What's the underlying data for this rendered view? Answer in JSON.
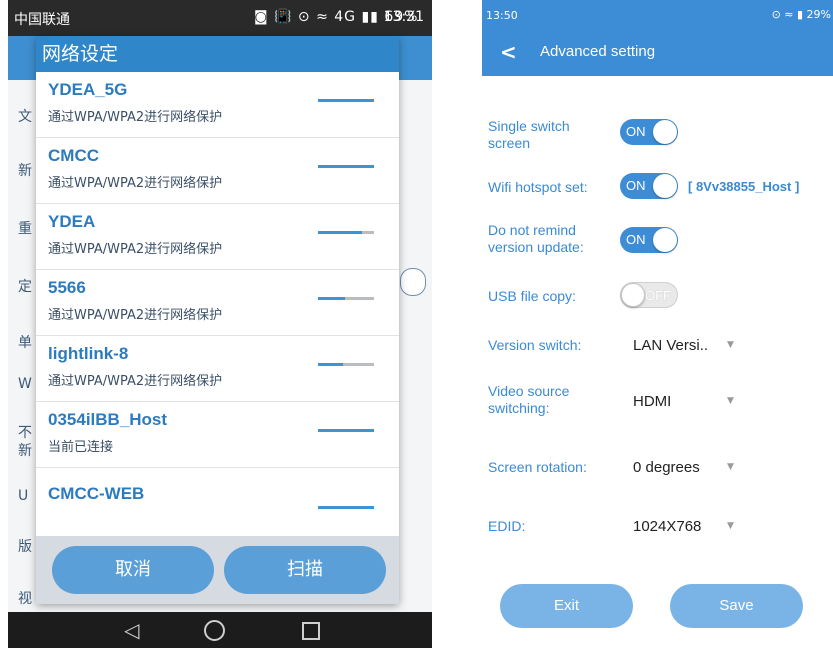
{
  "left": {
    "status": {
      "carrier": "中国联通",
      "icons": "◙ 📳 ⊙ ≈ 4G ▮▮ ",
      "battery": "69%",
      "time": "13:31"
    },
    "background_rows": [
      "文",
      "新",
      "重",
      "定",
      "单",
      "W",
      "不",
      "新",
      "U",
      "版",
      "视"
    ],
    "dialog": {
      "title": "网络设定",
      "networks": [
        {
          "ssid": "YDEA_5G",
          "status": "通过WPA/WPA2进行网络保护",
          "signal": 1.0
        },
        {
          "ssid": "CMCC",
          "status": "通过WPA/WPA2进行网络保护",
          "signal": 1.0
        },
        {
          "ssid": "YDEA",
          "status": "通过WPA/WPA2进行网络保护",
          "signal": 0.78
        },
        {
          "ssid": "5566",
          "status": "通过WPA/WPA2进行网络保护",
          "signal": 0.48
        },
        {
          "ssid": "lightlink-8",
          "status": "通过WPA/WPA2进行网络保护",
          "signal": 0.45
        },
        {
          "ssid": "0354ilBB_Host",
          "status": "当前已连接",
          "signal": 1.0
        },
        {
          "ssid": "CMCC-WEB",
          "status": "",
          "signal": 1.0
        }
      ],
      "cancel_label": "取消",
      "scan_label": "扫描"
    },
    "nav": {
      "back": "◁",
      "home": "○",
      "recent": "□"
    }
  },
  "right": {
    "status": {
      "time": "13:50",
      "battery": "29%"
    },
    "header": {
      "back": "<",
      "title": "Advanced setting"
    },
    "settings": {
      "single_switch": {
        "label": "Single switch screen",
        "value": "ON"
      },
      "wifi_hotspot": {
        "label": "Wifi hotspot set:",
        "value": "ON",
        "name": "[ 8Vv38855_Host ]"
      },
      "no_remind": {
        "label": "Do not remind version update:",
        "value": "ON"
      },
      "usb_copy": {
        "label": "USB file copy:",
        "value": "OFF"
      },
      "version_switch": {
        "label": "Version switch:",
        "value": "LAN Versi.."
      },
      "video_source": {
        "label": "Video source switching:",
        "value": "HDMI"
      },
      "screen_rotation": {
        "label": "Screen rotation:",
        "value": "0 degrees"
      },
      "edid": {
        "label": "EDID:",
        "value": "1024X768"
      }
    },
    "caret": "▼",
    "exit_label": "Exit",
    "save_label": "Save"
  },
  "colors": {
    "primary": "#3d8cd6",
    "dialog_title": "#2f86c9",
    "button": "#5a9fd8",
    "right_button": "#7ab4e6"
  }
}
